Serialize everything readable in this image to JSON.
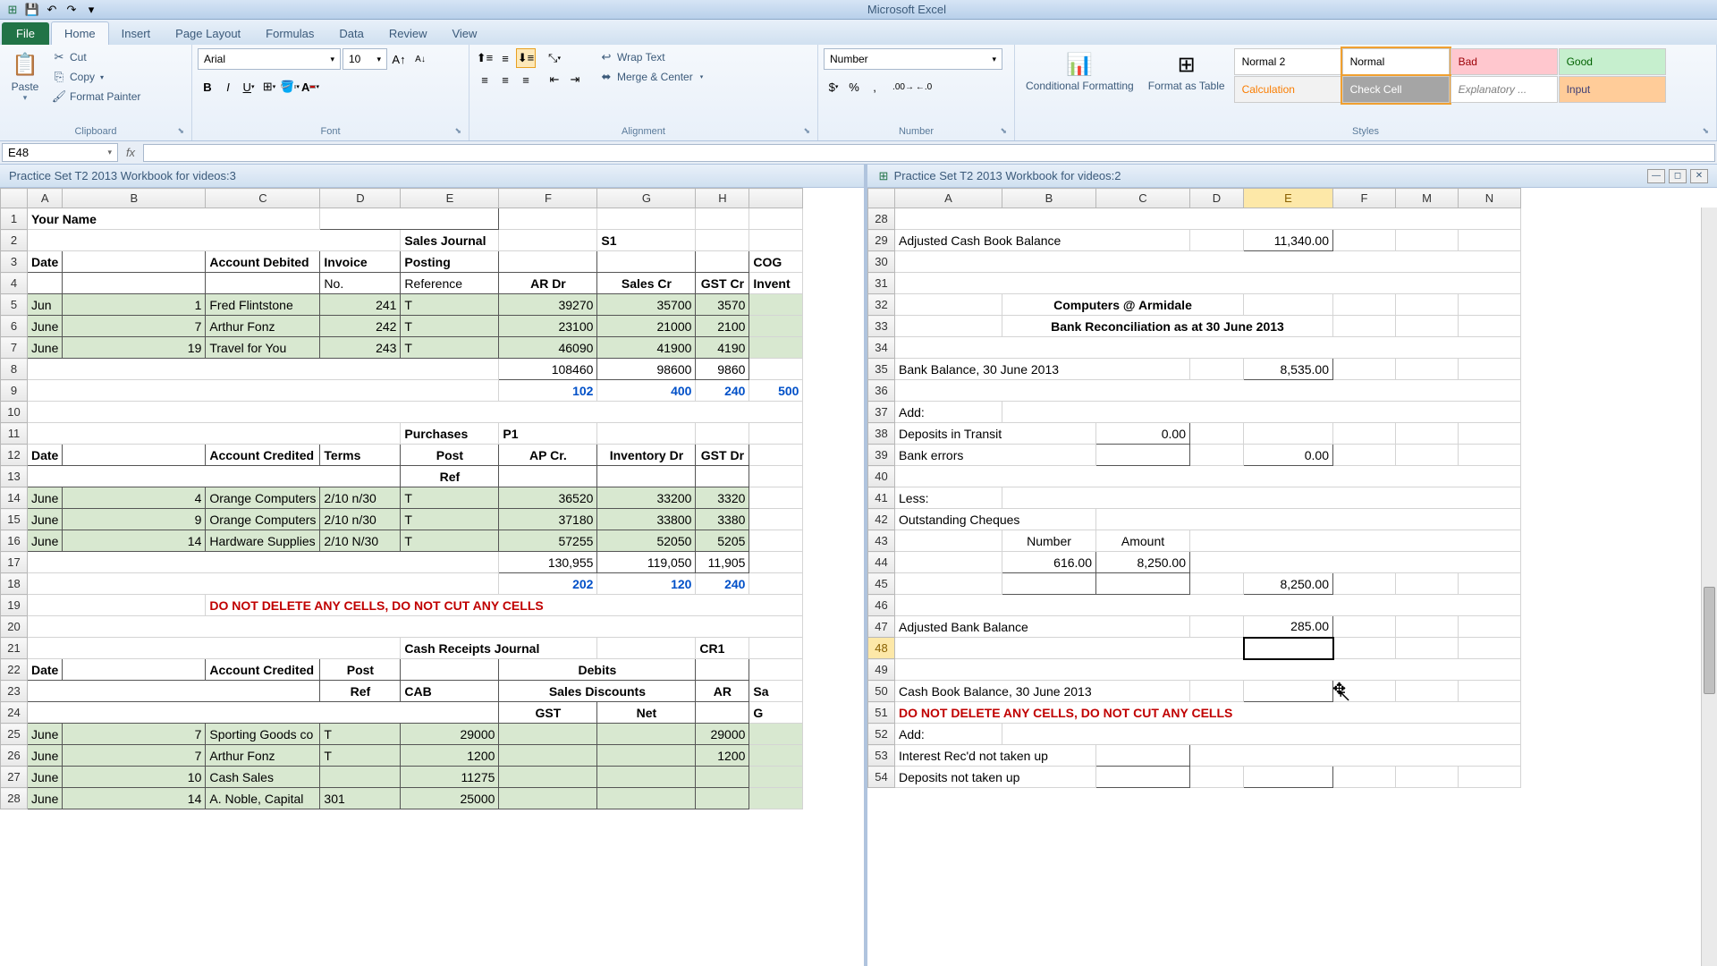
{
  "app": {
    "title": "Microsoft Excel"
  },
  "qat": {
    "save": "💾",
    "undo": "↶",
    "redo": "↷",
    "custom": "▾"
  },
  "tabs": {
    "file": "File",
    "home": "Home",
    "insert": "Insert",
    "page": "Page Layout",
    "formulas": "Formulas",
    "data": "Data",
    "review": "Review",
    "view": "View"
  },
  "ribbon": {
    "clipboard": {
      "label": "Clipboard",
      "paste": "Paste",
      "cut": "Cut",
      "copy": "Copy",
      "painter": "Format Painter"
    },
    "font": {
      "label": "Font",
      "name": "Arial",
      "size": "10"
    },
    "alignment": {
      "label": "Alignment",
      "wrap": "Wrap Text",
      "merge": "Merge & Center"
    },
    "number": {
      "label": "Number",
      "format": "Number"
    },
    "styles": {
      "label": "Styles",
      "cond": "Conditional Formatting",
      "table": "Format as Table",
      "cells": [
        {
          "t": "Normal 2",
          "bg": "#fff",
          "c": "#000"
        },
        {
          "t": "Normal",
          "bg": "#fff",
          "c": "#000",
          "sel": true
        },
        {
          "t": "Bad",
          "bg": "#ffc7ce",
          "c": "#9c0006"
        },
        {
          "t": "Good",
          "bg": "#c6efce",
          "c": "#006100"
        },
        {
          "t": "Calculation",
          "bg": "#f2f2f2",
          "c": "#fa7d00"
        },
        {
          "t": "Check Cell",
          "bg": "#a5a5a5",
          "c": "#fff",
          "sel": true
        },
        {
          "t": "Explanatory ...",
          "bg": "#fff",
          "c": "#7f7f7f",
          "i": true
        },
        {
          "t": "Input",
          "bg": "#ffcc99",
          "c": "#3f3f76"
        }
      ]
    }
  },
  "namebox": "E48",
  "docs": {
    "left": "Practice Set T2 2013 Workbook for videos:3",
    "right": "Practice Set T2 2013 Workbook for videos:2"
  },
  "left": {
    "cols": [
      "A",
      "B",
      "C",
      "D",
      "E",
      "F",
      "G",
      "H"
    ],
    "widths": [
      55,
      35,
      160,
      95,
      90,
      110,
      110,
      110,
      60
    ],
    "r1": {
      "a": "Your Name"
    },
    "r2": {
      "e": "Sales Journal",
      "g": "S1"
    },
    "r3": {
      "a": "Date",
      "c": "Account Debited",
      "d": "Invoice",
      "e": "Posting",
      "h": "COG"
    },
    "r4": {
      "d": "No.",
      "e": "Reference",
      "f": "AR Dr",
      "g": "Sales Cr",
      "h": "GST Cr",
      "i": "Invent"
    },
    "r5": {
      "a": "Jun",
      "b": "1",
      "c": "Fred Flintstone",
      "d": "241",
      "e": "T",
      "f": "39270",
      "g": "35700",
      "h": "3570"
    },
    "r6": {
      "a": "June",
      "b": "7",
      "c": "Arthur Fonz",
      "d": "242",
      "e": "T",
      "f": "23100",
      "g": "21000",
      "h": "2100"
    },
    "r7": {
      "a": "June",
      "b": "19",
      "c": "Travel for You",
      "d": "243",
      "e": "T",
      "f": "46090",
      "g": "41900",
      "h": "4190"
    },
    "r8": {
      "f": "108460",
      "g": "98600",
      "h": "9860"
    },
    "r9": {
      "f": "102",
      "g": "400",
      "h": "240",
      "i": "500"
    },
    "r11": {
      "e": "Purchases",
      "f": "P1"
    },
    "r12": {
      "a": "Date",
      "c": "Account Credited",
      "d": "Terms",
      "e": "Post",
      "f": "AP Cr.",
      "g": "Inventory Dr",
      "h": "GST Dr"
    },
    "r13": {
      "e": "Ref"
    },
    "r14": {
      "a": "June",
      "b": "4",
      "c": "Orange Computers",
      "d": "2/10 n/30",
      "e": "T",
      "f": "36520",
      "g": "33200",
      "h": "3320"
    },
    "r15": {
      "a": "June",
      "b": "9",
      "c": "Orange Computers",
      "d": "2/10 n/30",
      "e": "T",
      "f": "37180",
      "g": "33800",
      "h": "3380"
    },
    "r16": {
      "a": "June",
      "b": "14",
      "c": "Hardware Supplies",
      "d": "2/10 N/30",
      "e": "T",
      "f": "57255",
      "g": "52050",
      "h": "5205"
    },
    "r17": {
      "f": "130,955",
      "g": "119,050",
      "h": "11,905"
    },
    "r18": {
      "f": "202",
      "g": "120",
      "h": "240"
    },
    "r19": {
      "c": "DO NOT DELETE ANY CELLS, DO NOT CUT ANY CELLS"
    },
    "r21": {
      "e": "Cash Receipts Journal",
      "h": "CR1"
    },
    "r22": {
      "a": "Date",
      "c": "Account Credited",
      "d": "Post",
      "f": "Debits"
    },
    "r23": {
      "d": "Ref",
      "e": "CAB",
      "f": "Sales Discounts",
      "h": "AR",
      "i": "Sa"
    },
    "r24": {
      "f": "GST",
      "g": "Net",
      "i": "G"
    },
    "r25": {
      "a": "June",
      "b": "7",
      "c": "Sporting Goods co",
      "d": "T",
      "e": "29000",
      "h": "29000"
    },
    "r26": {
      "a": "June",
      "b": "7",
      "c": "Arthur Fonz",
      "d": "T",
      "e": "1200",
      "h": "1200"
    },
    "r27": {
      "a": "June",
      "b": "10",
      "c": "Cash Sales",
      "e": "11275"
    },
    "r28": {
      "a": "June",
      "b": "14",
      "c": "A. Noble, Capital",
      "d": "301",
      "e": "25000"
    }
  },
  "right": {
    "cols": [
      "A",
      "B",
      "C",
      "D",
      "E",
      "F",
      "M",
      "N"
    ],
    "widths": [
      120,
      105,
      105,
      60,
      100,
      70,
      70,
      70
    ],
    "r29": {
      "a": "Adjusted Cash Book Balance",
      "e": "11,340.00"
    },
    "r32": {
      "b": "Computers @ Armidale"
    },
    "r33": {
      "b": "Bank Reconciliation as at 30 June 2013"
    },
    "r35": {
      "a": "Bank Balance, 30 June 2013",
      "e": "8,535.00"
    },
    "r37": {
      "a": "Add:"
    },
    "r38": {
      "a": "Deposits in Transit",
      "c": "0.00"
    },
    "r39": {
      "a": "Bank errors",
      "e": "0.00"
    },
    "r41": {
      "a": "Less:"
    },
    "r42": {
      "a": "Outstanding Cheques"
    },
    "r43": {
      "b": "Number",
      "c": "Amount"
    },
    "r44": {
      "b": "616.00",
      "c": "8,250.00"
    },
    "r45": {
      "e": "8,250.00"
    },
    "r47": {
      "a": "Adjusted Bank Balance",
      "e": "285.00"
    },
    "r50": {
      "a": "Cash Book Balance, 30 June 2013"
    },
    "r51": {
      "a": "DO NOT DELETE ANY CELLS, DO NOT CUT ANY CELLS"
    },
    "r52": {
      "a": "Add:"
    },
    "r53": {
      "a": "Interest Rec'd not taken up"
    },
    "r54": {
      "a": "Deposits not taken up"
    }
  }
}
